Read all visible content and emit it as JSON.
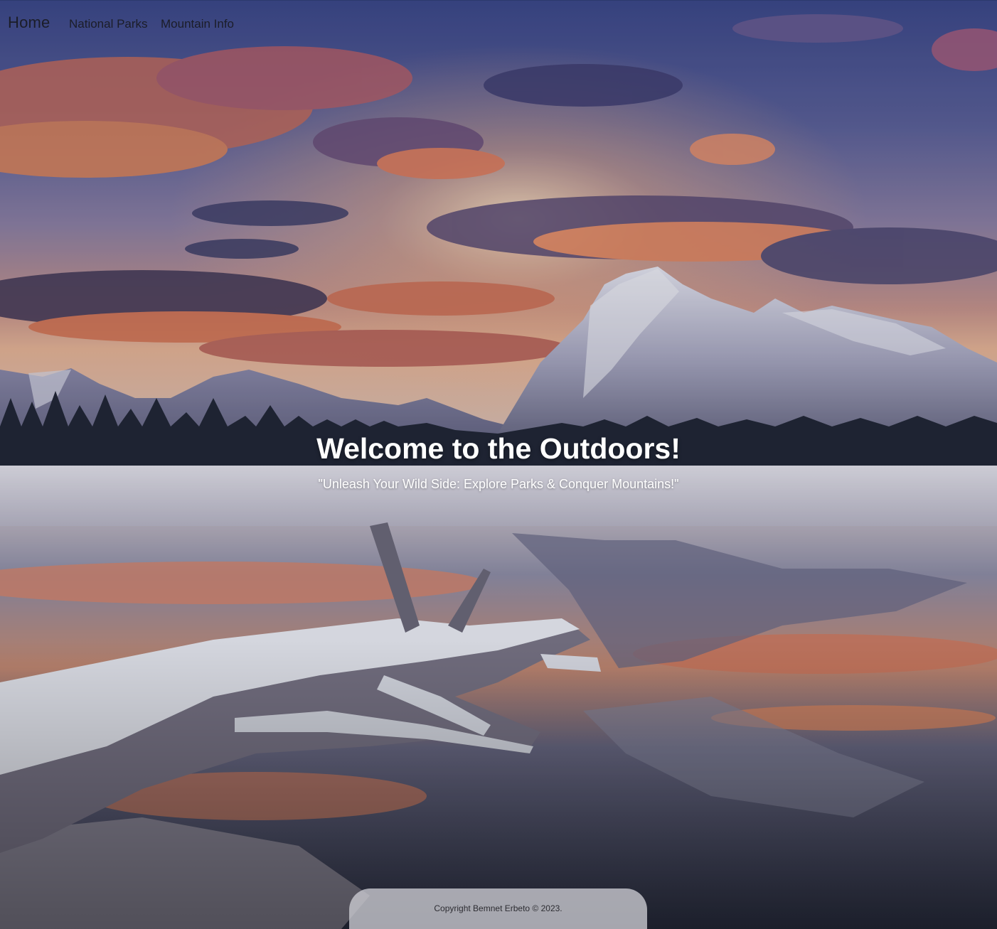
{
  "nav": {
    "home": "Home",
    "links": [
      "National Parks",
      "Mountain Info"
    ]
  },
  "hero": {
    "title": "Welcome to the Outdoors!",
    "subtitle": "\"Unleash Your Wild Side: Explore Parks & Conquer Mountains!\""
  },
  "footer": {
    "copyright": "Copyright Bemnet Erbeto © 2023."
  },
  "colors": {
    "nav_text": "#1b1d28",
    "hero_text": "#ffffff",
    "footer_bg": "#cdcdd4",
    "sky_top": "#3b4a8a",
    "sunset_orange": "#e0764e"
  },
  "background": {
    "scene": "mountain-lake-sunset-image"
  }
}
